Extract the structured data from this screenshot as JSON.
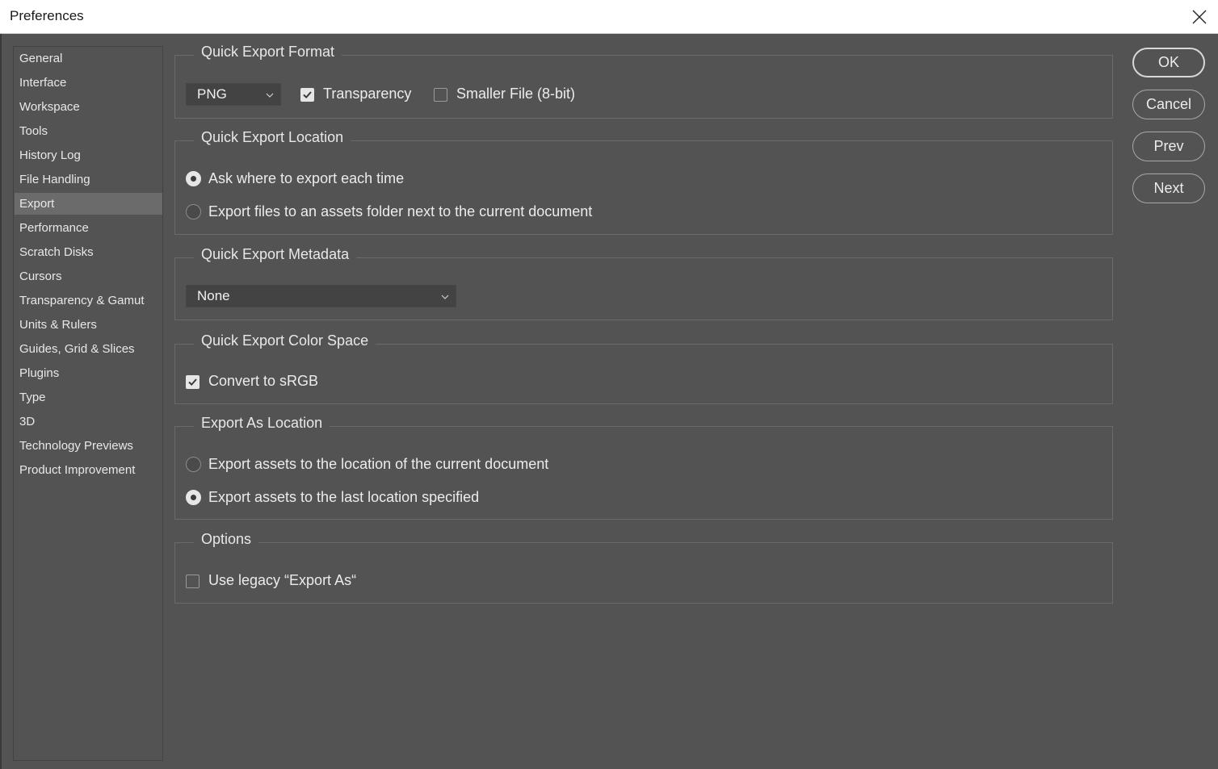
{
  "window": {
    "title": "Preferences",
    "close_icon": "close-icon"
  },
  "sidebar": {
    "items": [
      {
        "label": "General"
      },
      {
        "label": "Interface"
      },
      {
        "label": "Workspace"
      },
      {
        "label": "Tools"
      },
      {
        "label": "History Log"
      },
      {
        "label": "File Handling"
      },
      {
        "label": "Export"
      },
      {
        "label": "Performance"
      },
      {
        "label": "Scratch Disks"
      },
      {
        "label": "Cursors"
      },
      {
        "label": "Transparency & Gamut"
      },
      {
        "label": "Units & Rulers"
      },
      {
        "label": "Guides, Grid & Slices"
      },
      {
        "label": "Plugins"
      },
      {
        "label": "Type"
      },
      {
        "label": "3D"
      },
      {
        "label": "Technology Previews"
      },
      {
        "label": "Product Improvement"
      }
    ],
    "selected": "Export"
  },
  "quick_export_format": {
    "legend": "Quick Export Format",
    "format_value": "PNG",
    "transparency_label": "Transparency",
    "transparency_checked": true,
    "smaller_file_label": "Smaller File (8-bit)",
    "smaller_file_checked": false
  },
  "quick_export_location": {
    "legend": "Quick Export Location",
    "option_ask": "Ask where to export each time",
    "option_assets": "Export files to an assets folder next to the current document",
    "selected": "ask"
  },
  "quick_export_metadata": {
    "legend": "Quick Export Metadata",
    "value": "None"
  },
  "quick_export_color_space": {
    "legend": "Quick Export Color Space",
    "convert_label": "Convert to sRGB",
    "convert_checked": true
  },
  "export_as_location": {
    "legend": "Export As Location",
    "option_current": "Export assets to the location of the current document",
    "option_last": "Export assets to the last location specified",
    "selected": "last"
  },
  "options": {
    "legend": "Options",
    "legacy_label": "Use legacy “Export As“",
    "legacy_checked": false
  },
  "buttons": {
    "ok": "OK",
    "cancel": "Cancel",
    "prev": "Prev",
    "next": "Next"
  },
  "colors": {
    "background": "#535353",
    "selected_item": "#6b6b6b",
    "titlebar": "#ffffff"
  }
}
